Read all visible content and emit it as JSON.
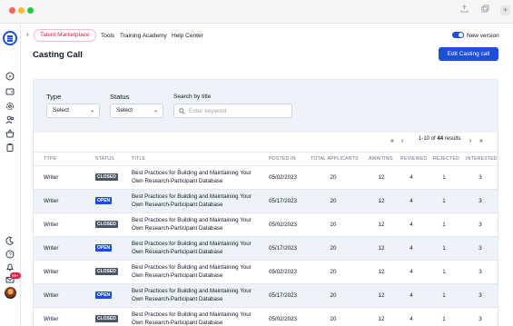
{
  "window": {
    "controls": [
      "close",
      "minimize",
      "maximize"
    ]
  },
  "titlebar_actions": [
    "upload-icon",
    "window-icon",
    "plus-icon"
  ],
  "sidebar": {
    "badge_count": "99+",
    "icons": [
      "menu-logo-icon",
      "compass-icon",
      "wallet-icon",
      "settings-icon",
      "users-icon",
      "basket-icon",
      "clipboard-icon",
      "moon-icon",
      "help-icon",
      "bell-icon",
      "mail-icon",
      "avatar"
    ]
  },
  "nav": {
    "active": "Talent Marketplace",
    "links": [
      "Tools",
      "Training Academy",
      "Help Center"
    ],
    "new_version_label": "New version",
    "new_version_on": true
  },
  "page": {
    "title": "Casting Call",
    "primary_action": "Edit Casting call"
  },
  "filters": {
    "type": {
      "label": "Type",
      "value": "Select"
    },
    "status": {
      "label": "Status",
      "value": "Select"
    },
    "search": {
      "label": "Search by title",
      "placeholder": "Enter keyword",
      "value": ""
    }
  },
  "pagination": {
    "range": "1-10",
    "of_label": "of",
    "total": "44",
    "unit": "results"
  },
  "table": {
    "columns": [
      "TYPE",
      "STATUS",
      "TITLE",
      "POSTED IN",
      "TOTAL APPLICANTS",
      "AWAITING",
      "REVIEWED",
      "REJECTED",
      "INTERESTED"
    ],
    "rows": [
      {
        "type": "Writer",
        "status": "CLOSED",
        "title_line1": "Best Practices for Building and Maintaining Your",
        "title_line2": "Own Research-Participant Database",
        "posted": "05/02/2023",
        "total": "20",
        "awaiting": "12",
        "reviewed": "4",
        "rejected": "1",
        "interested": "3"
      },
      {
        "type": "Writer",
        "status": "OPEN",
        "title_line1": "Best Practices for Building and Maintaining Your",
        "title_line2": "Own Research-Participant Database",
        "posted": "05/17/2023",
        "total": "20",
        "awaiting": "12",
        "reviewed": "4",
        "rejected": "1",
        "interested": "3"
      },
      {
        "type": "Writer",
        "status": "CLOSED",
        "title_line1": "Best Practices for Building and Maintaining Your",
        "title_line2": "Own Research-Participant Database",
        "posted": "05/02/2023",
        "total": "20",
        "awaiting": "12",
        "reviewed": "4",
        "rejected": "1",
        "interested": "3"
      },
      {
        "type": "Writer",
        "status": "OPEN",
        "title_line1": "Best Practices for Building and Maintaining Your",
        "title_line2": "Own Research-Participant Database",
        "posted": "05/17/2023",
        "total": "20",
        "awaiting": "12",
        "reviewed": "4",
        "rejected": "1",
        "interested": "3"
      },
      {
        "type": "Writer",
        "status": "CLOSED",
        "title_line1": "Best Practices for Building and Maintaining Your",
        "title_line2": "Own Research-Participant Database",
        "posted": "05/02/2023",
        "total": "20",
        "awaiting": "12",
        "reviewed": "4",
        "rejected": "1",
        "interested": "3"
      },
      {
        "type": "Writer",
        "status": "OPEN",
        "title_line1": "Best Practices for Building and Maintaining Your",
        "title_line2": "Own Research-Participant Database",
        "posted": "05/17/2023",
        "total": "20",
        "awaiting": "12",
        "reviewed": "4",
        "rejected": "1",
        "interested": "3"
      },
      {
        "type": "Writer",
        "status": "CLOSED",
        "title_line1": "Best Practices for Building and Maintaining Your",
        "title_line2": "Own Research-Participant Database",
        "posted": "05/02/2023",
        "total": "20",
        "awaiting": "12",
        "reviewed": "4",
        "rejected": "1",
        "interested": "3"
      }
    ]
  },
  "colors": {
    "primary": "#1d4ed8",
    "active_nav": "#e11d48",
    "closed_badge": "#4b5563",
    "row_alt": "#eef3f9"
  }
}
